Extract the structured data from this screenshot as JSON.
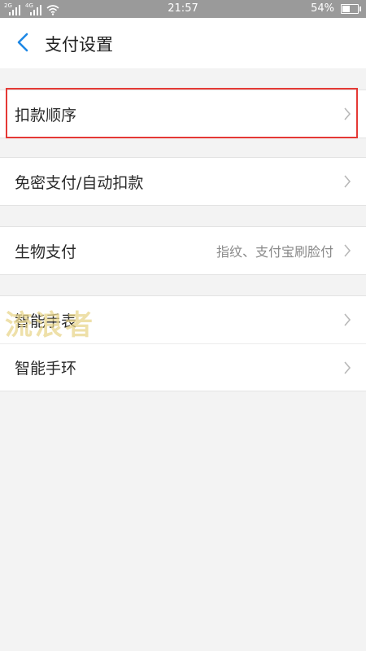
{
  "status_bar": {
    "sim1_tag": "2G",
    "sim2_tag": "4G",
    "time": "21:57",
    "battery_percent": "54%",
    "battery_level": 0.54,
    "icons": [
      "signal-2g-icon",
      "signal-4g-icon",
      "wifi-icon",
      "battery-icon"
    ]
  },
  "header": {
    "back_icon": "back-chevron-icon",
    "title": "支付设置"
  },
  "settings_groups": [
    {
      "items": [
        {
          "label": "扣款顺序",
          "value": "",
          "highlighted": true
        }
      ]
    },
    {
      "items": [
        {
          "label": "免密支付/自动扣款",
          "value": ""
        }
      ]
    },
    {
      "items": [
        {
          "label": "生物支付",
          "value": "指纹、支付宝刷脸付"
        }
      ]
    },
    {
      "items": [
        {
          "label": "智能手表",
          "value": ""
        },
        {
          "label": "智能手环",
          "value": ""
        }
      ]
    }
  ],
  "watermark": "流浪者",
  "colors": {
    "accent": "#1e88e5",
    "highlight_border": "#e53935",
    "status_bar": "#9a9a9a",
    "background": "#f3f3f3"
  }
}
